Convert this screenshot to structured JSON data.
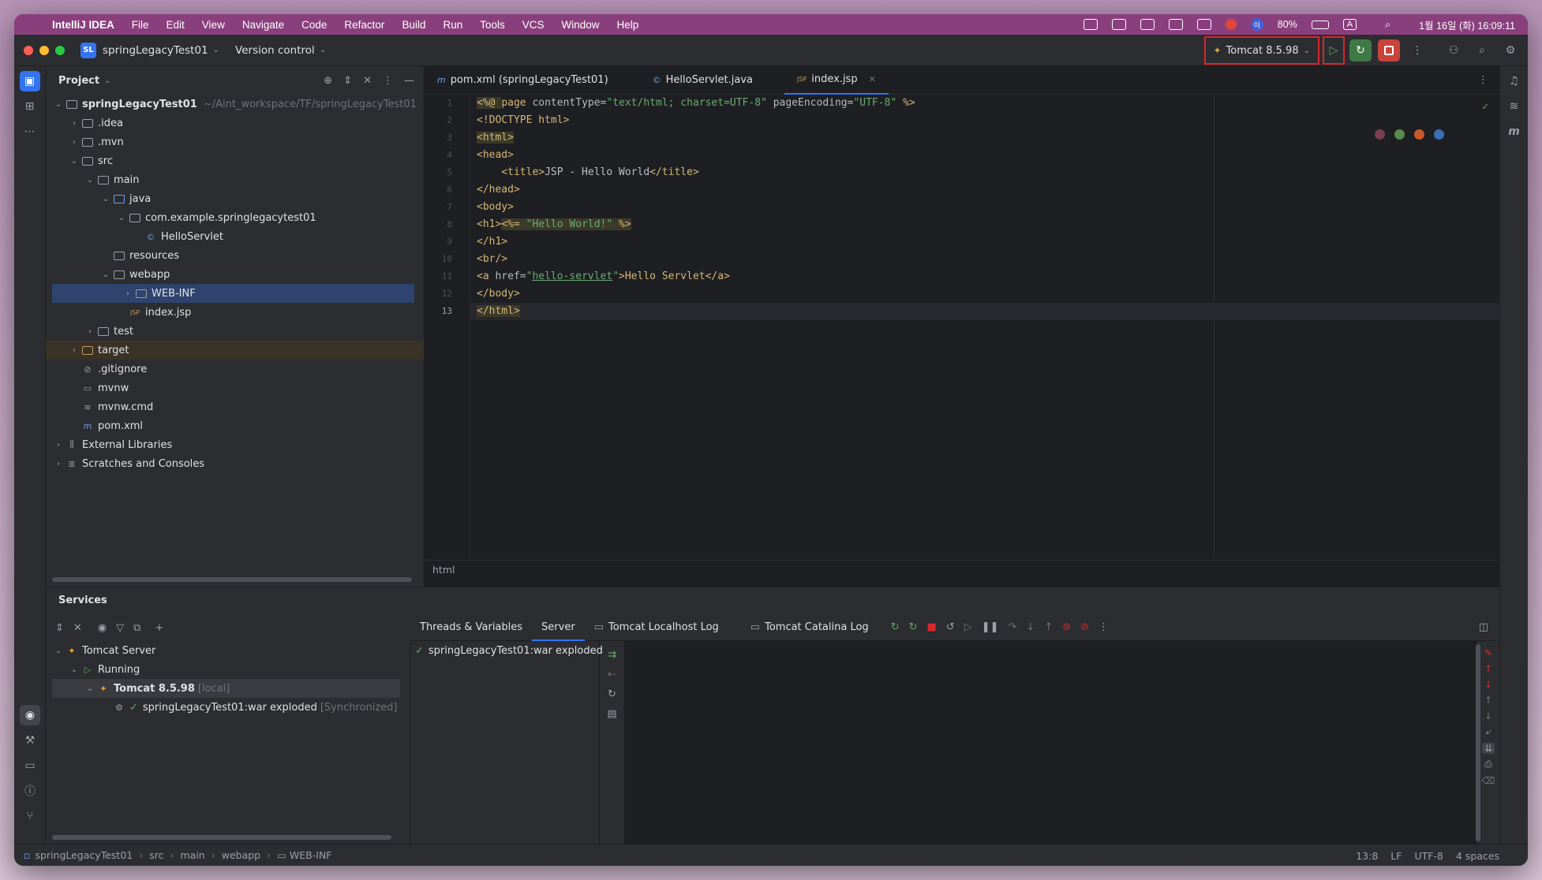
{
  "macbar": {
    "app": "IntelliJ IDEA",
    "menus": [
      "File",
      "Edit",
      "View",
      "Navigate",
      "Code",
      "Refactor",
      "Build",
      "Run",
      "Tools",
      "VCS",
      "Window",
      "Help"
    ],
    "battery": "80%",
    "clock": "1월 16일 (화) 16:09:11",
    "input_source": "A",
    "user_badge": "이"
  },
  "toolbar": {
    "project_badge": "SL",
    "project_name": "springLegacyTest01",
    "vcs": "Version control",
    "run_config": "Tomcat 8.5.98"
  },
  "project_panel": {
    "title": "Project",
    "root_name": "springLegacyTest01",
    "root_path": "~/Aint_workspace/TF/springLegacyTest01",
    "items": {
      "idea": ".idea",
      "mvn": ".mvn",
      "src": "src",
      "main": "main",
      "java": "java",
      "package": "com.example.springlegacytest01",
      "servlet": "HelloServlet",
      "resources": "resources",
      "webapp": "webapp",
      "webinf": "WEB-INF",
      "indexjsp": "index.jsp",
      "test": "test",
      "target": "target",
      "gitignore": ".gitignore",
      "mvnw": "mvnw",
      "mvnwcmd": "mvnw.cmd",
      "pom": "pom.xml",
      "extlibs": "External Libraries",
      "scratches": "Scratches and Consoles"
    }
  },
  "tabs": [
    {
      "label": "pom.xml (springLegacyTest01)",
      "icon": "m"
    },
    {
      "label": "HelloServlet.java",
      "icon": "©"
    },
    {
      "label": "index.jsp",
      "icon": "JSP"
    }
  ],
  "editor": {
    "line_numbers": [
      "1",
      "2",
      "3",
      "4",
      "5",
      "6",
      "7",
      "8",
      "9",
      "10",
      "11",
      "12",
      "13"
    ],
    "breadcrumb": "html",
    "lines": {
      "l1a": "<%@ ",
      "l1b": "page ",
      "l1c": "contentType=",
      "l1d": "\"text/html; charset=UTF-8\"",
      "l1e": " pageEncoding=",
      "l1f": "\"UTF-8\"",
      "l1g": " %>",
      "l2": "<!DOCTYPE html>",
      "l3": "<html>",
      "l4": "<head>",
      "l5a": "    <title>",
      "l5b": "JSP - Hello World",
      "l5c": "</title>",
      "l6": "</head>",
      "l7": "<body>",
      "l8a": "<h1>",
      "l8b": "<%= ",
      "l8c": "\"Hello World!\"",
      "l8d": " %>",
      "l9": "</h1>",
      "l10": "<br/>",
      "l11a": "<a ",
      "l11b": "href=",
      "l11c": "\"",
      "l11d": "hello-servlet",
      "l11e": "\"",
      "l11f": ">Hello Servlet</a>",
      "l12": "</body>",
      "l13": "</html>"
    }
  },
  "services": {
    "title": "Services",
    "tree": {
      "server": "Tomcat Server",
      "running": "Running",
      "tomcat": "Tomcat 8.5.98",
      "tomcat_tag": "[local]",
      "artifact": "springLegacyTest01:war exploded",
      "artifact_tag": "[Synchronized]"
    },
    "tabs": [
      "Threads & Variables",
      "Server",
      "Tomcat Localhost Log",
      "Tomcat Catalina Log"
    ],
    "deployment": "springLegacyTest01:war exploded"
  },
  "statusbar": {
    "path": [
      "springLegacyTest01",
      "src",
      "main",
      "webapp",
      "WEB-INF"
    ],
    "position": "13:8",
    "line_sep": "LF",
    "encoding": "UTF-8",
    "indent": "4 spaces"
  },
  "colors": {
    "accent": "#3574f0",
    "highlight_red": "#d6282e",
    "run_green": "#5fad65"
  }
}
